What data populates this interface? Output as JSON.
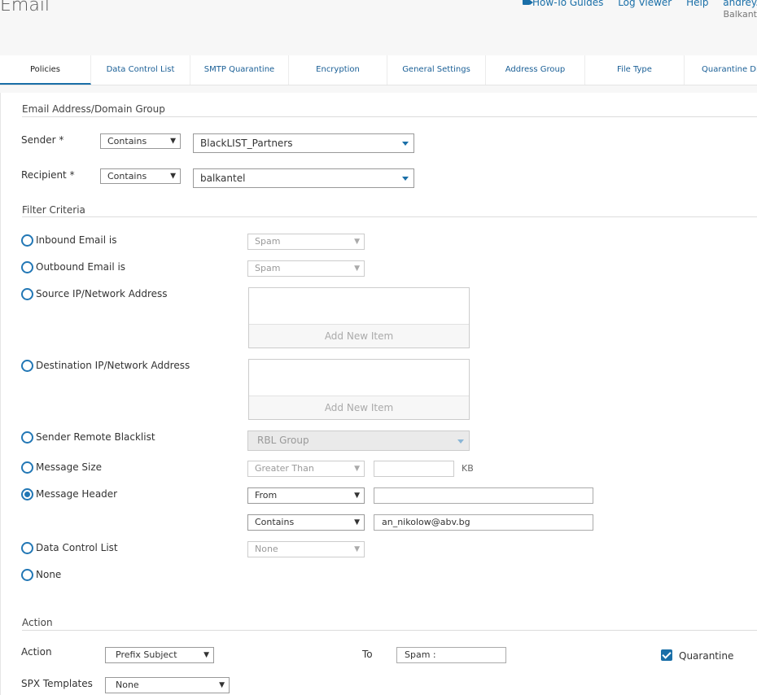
{
  "header": {
    "title": "Email",
    "links": {
      "howto": "How-To Guides",
      "logviewer": "Log Viewer",
      "help": "Help",
      "user": "andrey.nik"
    },
    "org": "Balkant"
  },
  "tabs": [
    {
      "label": "Policies",
      "active": true
    },
    {
      "label": "Data Control List"
    },
    {
      "label": "SMTP Quarantine"
    },
    {
      "label": "Encryption"
    },
    {
      "label": "General Settings"
    },
    {
      "label": "Address Group"
    },
    {
      "label": "File Type"
    },
    {
      "label": "Quarantine Dig"
    }
  ],
  "group_section": {
    "title": "Email Address/Domain Group",
    "sender": {
      "label": "Sender *",
      "operator": "Contains",
      "value": "BlackLIST_Partners"
    },
    "recipient": {
      "label": "Recipient *",
      "operator": "Contains",
      "value": "balkantel"
    }
  },
  "filter_section": {
    "title": "Filter Criteria",
    "inbound": {
      "label": "Inbound Email is",
      "value": "Spam"
    },
    "outbound": {
      "label": "Outbound Email is",
      "value": "Spam"
    },
    "source_ip": {
      "label": "Source IP/Network Address",
      "add": "Add New Item"
    },
    "dest_ip": {
      "label": "Destination IP/Network Address",
      "add": "Add New Item"
    },
    "rbl": {
      "label": "Sender Remote Blacklist",
      "value": "RBL Group"
    },
    "msg_size": {
      "label": "Message Size",
      "operator": "Greater Than",
      "value": "",
      "unit": "KB"
    },
    "msg_header": {
      "label": "Message Header",
      "header": "From",
      "header_value": "",
      "operator": "Contains",
      "value": "an_nikolow@abv.bg",
      "selected": true
    },
    "dcl": {
      "label": "Data Control List",
      "value": "None"
    },
    "none": {
      "label": "None"
    }
  },
  "action_section": {
    "title": "Action",
    "action_label": "Action",
    "action_value": "Prefix Subject",
    "to_label": "To",
    "to_value": "Spam :",
    "quarantine_label": "Quarantine",
    "quarantine_checked": true,
    "spx_label": "SPX Templates",
    "spx_value": "None"
  },
  "colors": {
    "accent": "#1a6fa8",
    "radio": "#2277b5"
  }
}
